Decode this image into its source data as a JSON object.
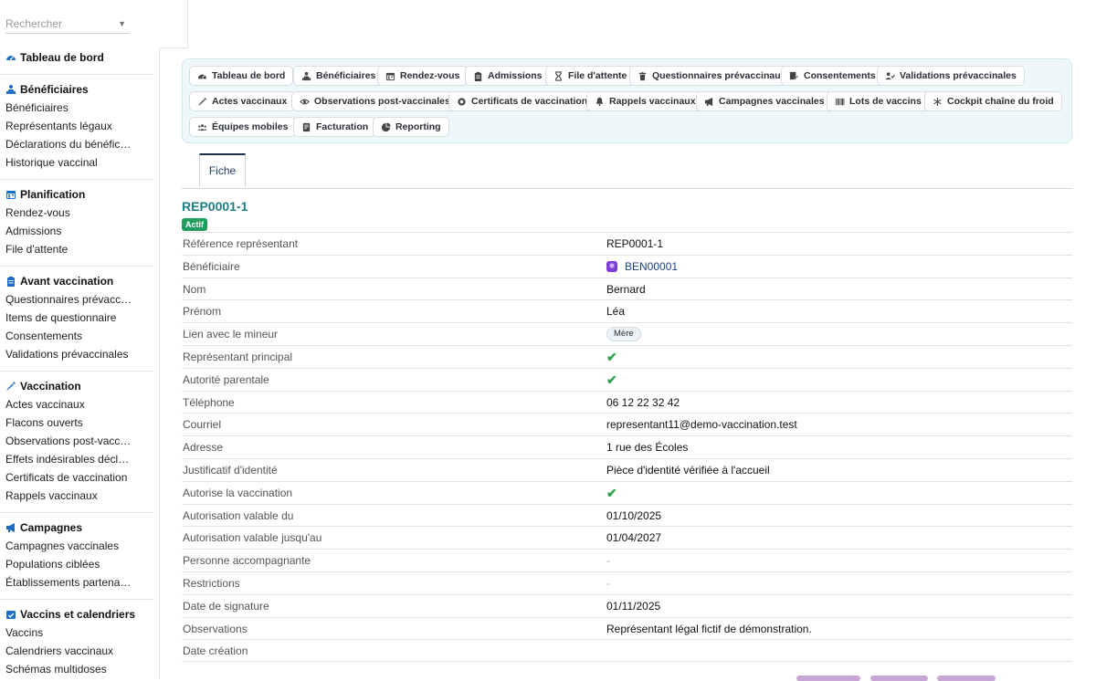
{
  "sidebar": {
    "search_placeholder": "Rechercher",
    "dashboard": "Tableau de bord",
    "groups": [
      {
        "title": "Bénéficiaires",
        "icon": "people-icon",
        "items": [
          "Bénéficiaires",
          "Représentants légaux",
          "Déclarations du bénéficia…",
          "Historique vaccinal"
        ]
      },
      {
        "title": "Planification",
        "icon": "calendar-icon",
        "items": [
          "Rendez-vous",
          "Admissions",
          "File d'attente"
        ]
      },
      {
        "title": "Avant vaccination",
        "icon": "clipboard-icon",
        "items": [
          "Questionnaires prévaccin…",
          "Items de questionnaire",
          "Consentements",
          "Validations prévaccinales"
        ]
      },
      {
        "title": "Vaccination",
        "icon": "syringe-icon",
        "items": [
          "Actes vaccinaux",
          "Flacons ouverts",
          "Observations post-vaccin…",
          "Effets indésirables déclarés",
          "Certificats de vaccination",
          "Rappels vaccinaux"
        ]
      },
      {
        "title": "Campagnes",
        "icon": "megaphone-icon",
        "items": [
          "Campagnes vaccinales",
          "Populations ciblées",
          "Établissements partenaires"
        ]
      },
      {
        "title": "Vaccins et calendriers",
        "icon": "calendar-check-icon",
        "items": [
          "Vaccins",
          "Calendriers vaccinaux",
          "Schémas multidoses"
        ]
      }
    ]
  },
  "modules": [
    {
      "label": "Tableau de bord",
      "icon": "dashboard-icon"
    },
    {
      "label": "Bénéficiaires",
      "icon": "people-icon"
    },
    {
      "label": "Rendez-vous",
      "icon": "calendar-icon"
    },
    {
      "label": "Admissions",
      "icon": "clipboard-icon"
    },
    {
      "label": "File d'attente",
      "icon": "hourglass-icon"
    },
    {
      "label": "Questionnaires prévaccinaux",
      "icon": "trash-icon"
    },
    {
      "label": "Consentements",
      "icon": "signature-icon"
    },
    {
      "label": "Validations prévaccinales",
      "icon": "user-check-icon"
    },
    {
      "label": "Actes vaccinaux",
      "icon": "syringe-icon"
    },
    {
      "label": "Observations post-vaccinales",
      "icon": "eye-icon"
    },
    {
      "label": "Certificats de vaccination",
      "icon": "seal-icon"
    },
    {
      "label": "Rappels vaccinaux",
      "icon": "bell-icon"
    },
    {
      "label": "Campagnes vaccinales",
      "icon": "megaphone-icon"
    },
    {
      "label": "Lots de vaccins",
      "icon": "barcode-icon"
    },
    {
      "label": "Cockpit chaîne du froid",
      "icon": "snowflake-icon"
    },
    {
      "label": "Équipes mobiles",
      "icon": "team-icon"
    },
    {
      "label": "Facturation",
      "icon": "invoice-icon"
    },
    {
      "label": "Reporting",
      "icon": "pie-chart-icon"
    }
  ],
  "tabs": {
    "active": "Fiche"
  },
  "record": {
    "title": "REP0001-1",
    "status": "Actif",
    "fields": [
      {
        "label": "Référence représentant",
        "value": "REP0001-1",
        "kind": "text"
      },
      {
        "label": "Bénéficiaire",
        "value": "BEN00001",
        "kind": "link"
      },
      {
        "label": "Nom",
        "value": "Bernard",
        "kind": "text"
      },
      {
        "label": "Prénom",
        "value": "Léa",
        "kind": "text"
      },
      {
        "label": "Lien avec le mineur",
        "value": "Mère",
        "kind": "pill"
      },
      {
        "label": "Représentant principal",
        "value": "✔",
        "kind": "check"
      },
      {
        "label": "Autorité parentale",
        "value": "✔",
        "kind": "check"
      },
      {
        "label": "Téléphone",
        "value": "06 12 22 32 42",
        "kind": "text"
      },
      {
        "label": "Courriel",
        "value": "representant11@demo-vaccination.test",
        "kind": "text"
      },
      {
        "label": "Adresse",
        "value": "1 rue des Écoles",
        "kind": "text"
      },
      {
        "label": "Justificatif d'identité",
        "value": "Pièce d'identité vérifiée à l'accueil",
        "kind": "text"
      },
      {
        "label": "Autorise la vaccination",
        "value": "✔",
        "kind": "check"
      },
      {
        "label": "Autorisation valable du",
        "value": "01/10/2025",
        "kind": "text"
      },
      {
        "label": "Autorisation valable jusqu'au",
        "value": "01/04/2027",
        "kind": "text"
      },
      {
        "label": "Personne accompagnante",
        "value": "-",
        "kind": "dash"
      },
      {
        "label": "Restrictions",
        "value": "-",
        "kind": "dash"
      },
      {
        "label": "Date de signature",
        "value": "01/11/2025",
        "kind": "text"
      },
      {
        "label": "Observations",
        "value": "Représentant légal fictif de démonstration.",
        "kind": "text"
      },
      {
        "label": "Date création",
        "value": "",
        "kind": "text"
      }
    ]
  }
}
